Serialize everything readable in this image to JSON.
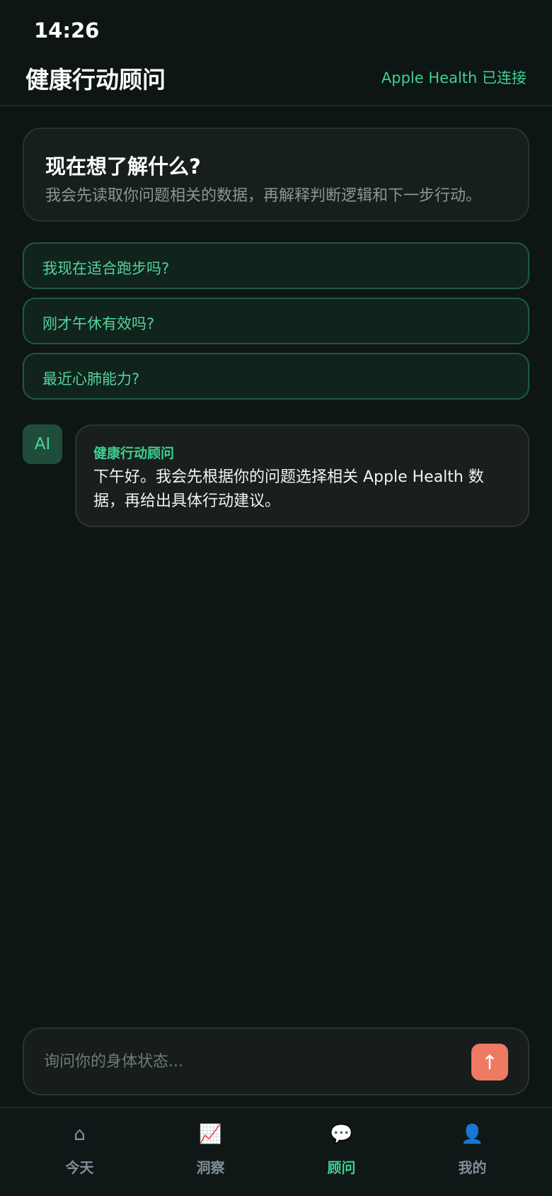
{
  "status_bar": {
    "time": "14:26"
  },
  "header": {
    "title": "健康行动顾问",
    "connection_status": "Apple Health 已连接"
  },
  "intro": {
    "title": "现在想了解什么?",
    "description": "我会先读取你问题相关的数据，再解释判断逻辑和下一步行动。"
  },
  "suggestions": [
    {
      "label": "我现在适合跑步吗?"
    },
    {
      "label": "刚才午休有效吗?"
    },
    {
      "label": "最近心肺能力?"
    }
  ],
  "message": {
    "avatar": "AI",
    "sender": "健康行动顾问",
    "text": "下午好。我会先根据你的问题选择相关 Apple Health 数据，再给出具体行动建议。"
  },
  "composer": {
    "placeholder": "询问你的身体状态...",
    "send_icon": "arrow-up-icon",
    "send_symbol": "↑"
  },
  "tabs": [
    {
      "label": "今天",
      "icon": "home-icon",
      "glyph": "⌂",
      "active": false
    },
    {
      "label": "洞察",
      "icon": "chart-icon",
      "glyph": "📈",
      "active": false
    },
    {
      "label": "顾问",
      "icon": "speech-bubble-icon",
      "glyph": "💬",
      "active": true
    },
    {
      "label": "我的",
      "icon": "user-icon",
      "glyph": "👤",
      "active": false
    }
  ],
  "colors": {
    "background": "#0d1614",
    "accent": "#3fcf91",
    "send_button": "#ee7a63"
  }
}
